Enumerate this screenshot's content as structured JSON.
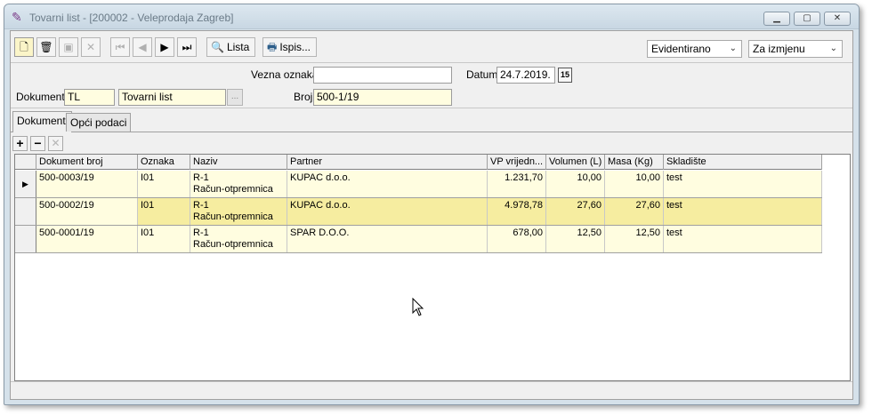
{
  "window": {
    "title": "Tovarni list - [200002 - Veleprodaja Zagreb]",
    "app_icon": "document-pen-icon"
  },
  "toolbar": {
    "lista_label": "Lista",
    "ispis_label": "Ispis...",
    "status_select": "Evidentirano",
    "mode_select": "Za izmjenu"
  },
  "form": {
    "vezna_oznaka_label": "Vezna oznaka",
    "vezna_oznaka_value": "",
    "datum_label": "Datum",
    "datum_value": "24.7.2019.",
    "calendar_glyph": "15",
    "dokument_label": "Dokument",
    "dokument_code": "TL",
    "dokument_name": "Tovarni list",
    "lookup_glyph": "...",
    "broj_label": "Broj",
    "broj_value": "500-1/19"
  },
  "tabs": [
    {
      "label": "Dokumenti",
      "active": true
    },
    {
      "label": "Opći podaci",
      "active": false
    }
  ],
  "grid": {
    "columns": [
      "Dokument broj",
      "Oznaka",
      "Naziv",
      "Partner",
      "VP vrijedn...",
      "Volumen (L)",
      "Masa (Kg)",
      "Skladište"
    ],
    "rows": [
      {
        "broj": "500-0003/19",
        "oznaka": "I01",
        "naziv1": "R-1",
        "naziv2": "Račun-otpremnica",
        "partner": "KUPAC d.o.o.",
        "vp": "1.231,70",
        "volumen": "10,00",
        "masa": "10,00",
        "skladiste": "test"
      },
      {
        "broj": "500-0002/19",
        "oznaka": "I01",
        "naziv1": "R-1",
        "naziv2": "Račun-otpremnica",
        "partner": "KUPAC d.o.o.",
        "vp": "4.978,78",
        "volumen": "27,60",
        "masa": "27,60",
        "skladiste": "test"
      },
      {
        "broj": "500-0001/19",
        "oznaka": "I01",
        "naziv1": "R-1",
        "naziv2": "Račun-otpremnica",
        "partner": "SPAR D.O.O.",
        "vp": "678,00",
        "volumen": "12,50",
        "masa": "12,50",
        "skladiste": "test"
      }
    ]
  },
  "colors": {
    "field_yellow": "#fffde0",
    "selected_row": "#f6eda0",
    "window_frame": "#d5e1ea"
  }
}
